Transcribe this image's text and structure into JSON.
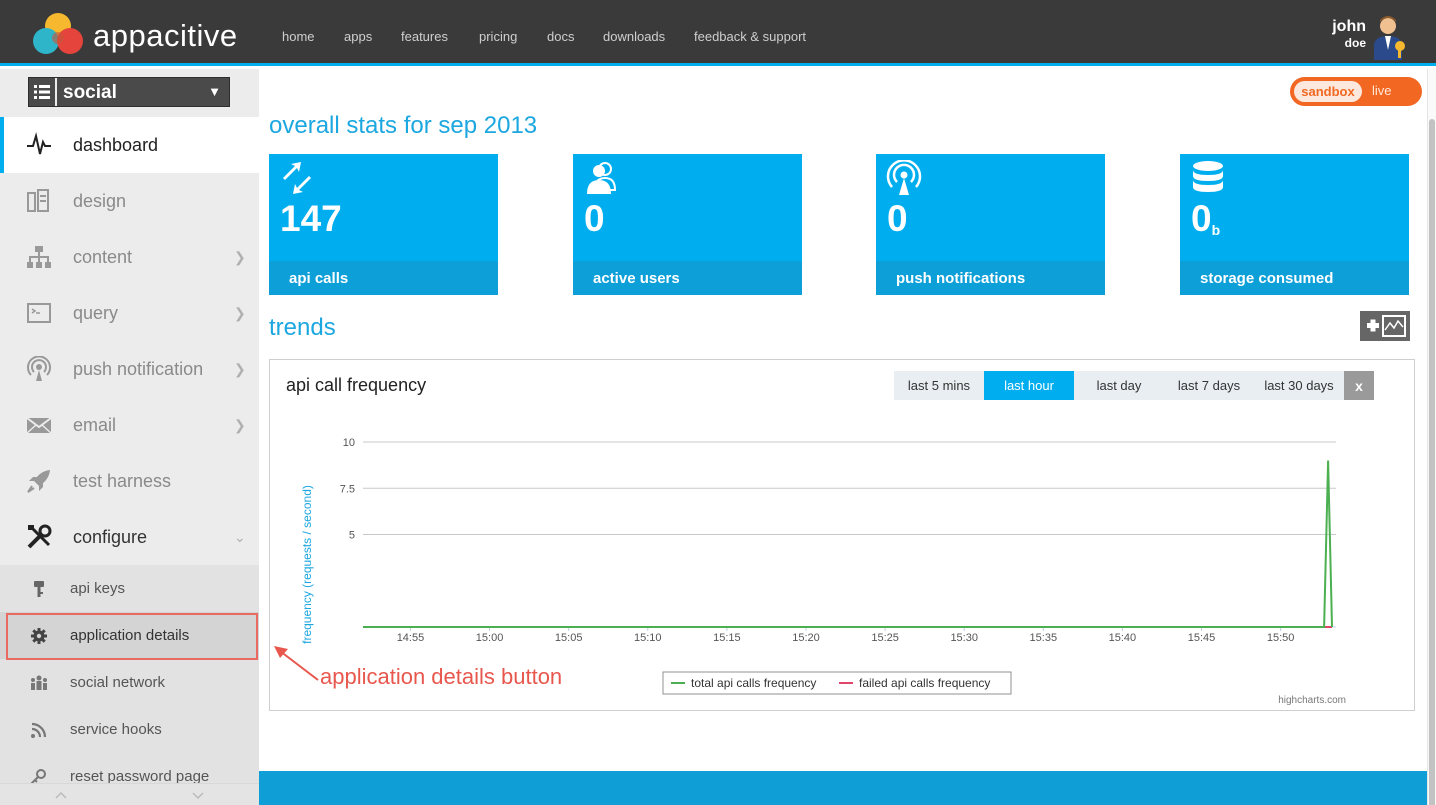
{
  "brand": {
    "name": "appacitive"
  },
  "nav": {
    "items": [
      "home",
      "apps",
      "features",
      "pricing",
      "docs",
      "downloads",
      "feedback & support"
    ]
  },
  "user": {
    "first": "john",
    "last": "doe"
  },
  "app_selector": {
    "value": "social"
  },
  "sidebar": {
    "items": [
      {
        "label": "dashboard",
        "icon": "pulse-icon"
      },
      {
        "label": "design",
        "icon": "design-icon"
      },
      {
        "label": "content",
        "icon": "sitemap-icon"
      },
      {
        "label": "query",
        "icon": "terminal-icon"
      },
      {
        "label": "push notification",
        "icon": "broadcast-icon"
      },
      {
        "label": "email",
        "icon": "envelope-icon"
      },
      {
        "label": "test harness",
        "icon": "rocket-icon"
      },
      {
        "label": "configure",
        "icon": "tools-icon"
      }
    ],
    "sub_items": [
      {
        "label": "api keys",
        "icon": "key-icon"
      },
      {
        "label": "application details",
        "icon": "gear-icon"
      },
      {
        "label": "social network",
        "icon": "people-icon"
      },
      {
        "label": "service hooks",
        "icon": "rss-icon"
      },
      {
        "label": "reset password page",
        "icon": "key-icon"
      }
    ]
  },
  "env_toggle": {
    "sandbox": "sandbox",
    "live": "live"
  },
  "stats": {
    "title": "overall stats for sep 2013",
    "tiles": [
      {
        "value": "147",
        "unit": "",
        "label": "api calls",
        "icon": "arrows-icon"
      },
      {
        "value": "0",
        "unit": "",
        "label": "active users",
        "icon": "user-icon"
      },
      {
        "value": "0",
        "unit": "",
        "label": "push notifications",
        "icon": "broadcast-icon"
      },
      {
        "value": "0",
        "unit": "b",
        "label": "storage consumed",
        "icon": "database-icon"
      }
    ]
  },
  "trends": {
    "title": "trends",
    "chart_title": "api call frequency",
    "ranges": [
      "last 5 mins",
      "last hour",
      "last day",
      "last 7 days",
      "last 30 days"
    ],
    "active_range": "last hour",
    "close_label": "x",
    "credits": "highcharts.com"
  },
  "chart_data": {
    "type": "line",
    "title": "api call frequency",
    "ylabel": "frequency (requests / second)",
    "xlabel": "",
    "x_ticks": [
      "14:55",
      "15:00",
      "15:05",
      "15:10",
      "15:15",
      "15:20",
      "15:25",
      "15:30",
      "15:35",
      "15:40",
      "15:45",
      "15:50"
    ],
    "y_ticks": [
      5,
      7.5,
      10
    ],
    "ylim": [
      0,
      10
    ],
    "grid": true,
    "legend_position": "bottom-center",
    "series": [
      {
        "name": "total api calls frequency",
        "color": "#4caf50",
        "points": [
          [
            "14:52",
            0
          ],
          [
            "15:52:45",
            0
          ],
          [
            "15:53:00",
            9
          ],
          [
            "15:53:15",
            0
          ]
        ]
      },
      {
        "name": "failed api calls frequency",
        "color": "#e0456b",
        "points": [
          [
            "14:52",
            0
          ],
          [
            "15:53:15",
            0
          ]
        ]
      }
    ]
  },
  "annotation": {
    "text": "application details button",
    "color": "#e8574d"
  }
}
